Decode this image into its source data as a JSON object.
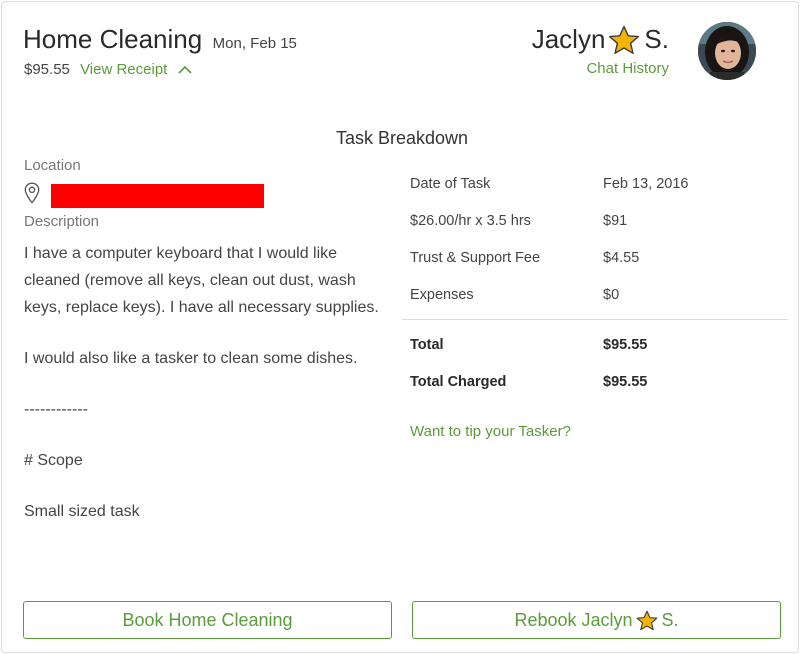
{
  "header": {
    "title": "Home Cleaning",
    "date": "Mon, Feb 15",
    "price": "$95.55",
    "receipt_link": "View Receipt"
  },
  "tasker": {
    "first_name": "Jaclyn",
    "last_initial": "S.",
    "chat_history": "Chat History"
  },
  "breakdown_title": "Task Breakdown",
  "details": {
    "location_label": "Location",
    "description_label": "Description",
    "description": [
      "I have a computer keyboard that I would like cleaned (remove all keys, clean out dust, wash keys, replace keys). I have all necessary supplies.",
      "I would also like a tasker to clean some dishes.",
      "------------",
      "# Scope",
      "Small sized task"
    ]
  },
  "breakdown": {
    "rows": [
      {
        "label": "Date of Task",
        "value": "Feb 13, 2016"
      },
      {
        "label": "$26.00/hr x 3.5 hrs",
        "value": "$91"
      },
      {
        "label": "Trust & Support Fee",
        "value": "$4.55"
      },
      {
        "label": "Expenses",
        "value": "$0"
      }
    ],
    "totals": [
      {
        "label": "Total",
        "value": "$95.55"
      },
      {
        "label": "Total Charged",
        "value": "$95.55"
      }
    ],
    "tip_link": "Want to tip your Tasker?"
  },
  "buttons": {
    "book": "Book Home Cleaning",
    "rebook_prefix": "Rebook Jaclyn",
    "rebook_suffix": "S."
  },
  "colors": {
    "accent": "#5a9c3c",
    "star": "#f5b400",
    "redaction": "#ff0000"
  },
  "icons": [
    "chevron-up-icon",
    "star-icon",
    "location-pin-icon"
  ]
}
